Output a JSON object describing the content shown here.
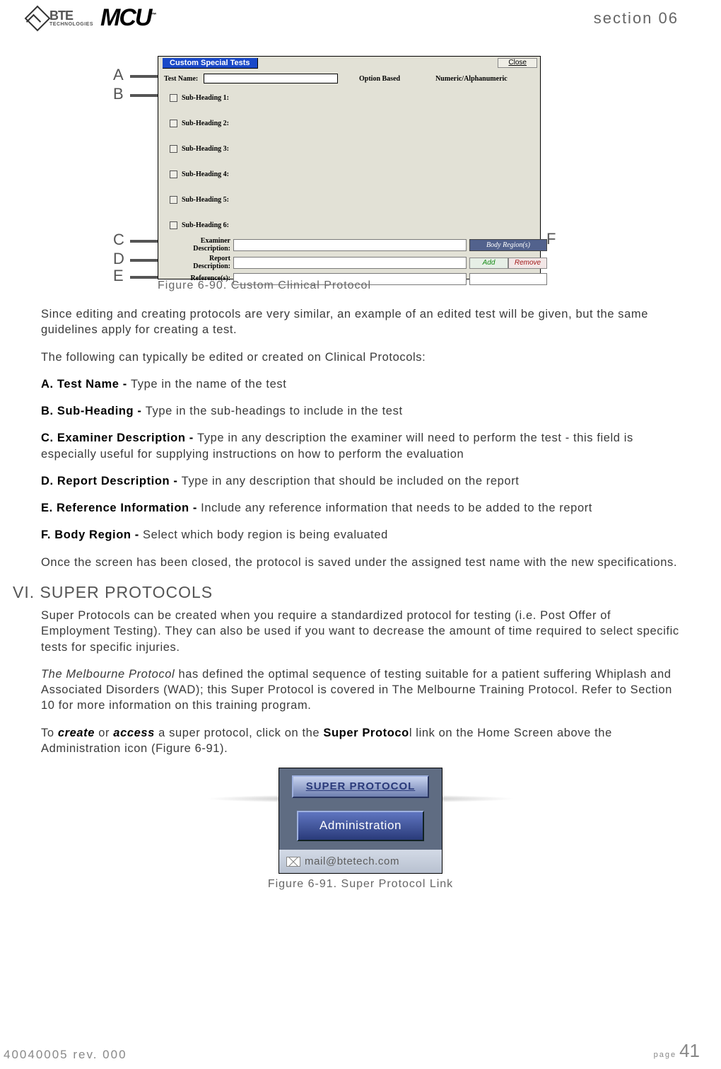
{
  "header": {
    "bte_big": "BTE",
    "bte_small": "TECHNOLOGIES",
    "mcu": "MCU",
    "tm": "™",
    "section": "section 06"
  },
  "fig90": {
    "callouts": {
      "A": "A",
      "B": "B",
      "C": "C",
      "D": "D",
      "E": "E",
      "F": "F"
    },
    "title": "Custom Special Tests",
    "close": "Close",
    "test_name_label": "Test Name:",
    "option_based": "Option Based",
    "numeric_alpha": "Numeric/Alphanumeric",
    "subheadings": [
      "Sub-Heading 1:",
      "Sub-Heading 2:",
      "Sub-Heading 3:",
      "Sub-Heading 4:",
      "Sub-Heading 5:",
      "Sub-Heading 6:"
    ],
    "examiner_label": "Examiner\nDescription:",
    "report_label": "Report\nDescription:",
    "references_label": "Reference(s):",
    "body_region_btn": "Body Region(s)",
    "add": "Add",
    "remove": "Remove",
    "caption": "Figure 6-90. Custom Clinical Protocol"
  },
  "body": {
    "p1": "Since editing and creating protocols are very similar, an example of an edited test will be given, but the same guidelines apply for creating a test.",
    "p2": "The following can typically be edited or created on Clinical Protocols:",
    "A_bold": "A. Test Name - ",
    "A_text": "Type in the name of the test",
    "B_bold": "B. Sub-Heading - ",
    "B_text": "Type in the sub-headings to include in the test",
    "C_bold": "C. Examiner Description - ",
    "C_text": "Type in any description the examiner will need to perform the test - this field is especially useful for supplying instructions on how to perform the evaluation",
    "D_bold": "D. Report Description - ",
    "D_text": "Type in any description that should be included on the report",
    "E_bold": "E. Reference Information - ",
    "E_text": "Include any reference information that needs to be added to the report",
    "F_bold": "F. Body Region - ",
    "F_text": "Select which body region is being evaluated",
    "p3": "Once the screen has been closed, the protocol is saved under the assigned test name with the new specifications.",
    "h2": "VI. SUPER PROTOCOLS",
    "sp1": "Super Protocols can be created when you require a standardized protocol for testing (i.e. Post Offer of Employment Testing). They can also be used if you want to decrease the amount of time required to select specific tests for specific injuries.",
    "sp2a": "The Melbourne Protocol",
    "sp2b": " has defined the optimal sequence of testing suitable for a patient suffering Whiplash and Associated Disorders (WAD); this Super Protocol is covered in The Melbourne Training Protocol. Refer to Section 10 for more information on this training program.",
    "sp3a": "To ",
    "sp3_create": "create",
    "sp3b": " or ",
    "sp3_access": "access",
    "sp3c": " a super protocol, click on the ",
    "sp3_super": "Super Protoco",
    "sp3d": "l link on the Home Screen above the Administration icon (Figure 6-91)."
  },
  "fig91": {
    "super_protocol": "SUPER PROTOCOL",
    "administration": "Administration",
    "mail": "mail@btetech.com",
    "caption": "Figure 6-91. Super Protocol Link"
  },
  "footer": {
    "doc": "40040005 rev. 000",
    "page_word": "page",
    "page_num": "41"
  }
}
